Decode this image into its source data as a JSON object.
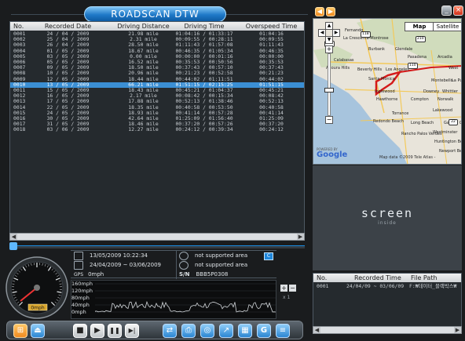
{
  "app": {
    "title": "ROADSCAN DTW"
  },
  "window_buttons": {
    "minimize": "_",
    "close": "×"
  },
  "main_list": {
    "columns": [
      "No.",
      "Recorded Date",
      "Driving Distance",
      "Driving Time",
      "Overspeed Time"
    ],
    "rows": [
      [
        "0001",
        "24 / 04 / 2009",
        "21.98 mile",
        "01:04:16 / 01:33:17",
        "01:04:16"
      ],
      [
        "0002",
        "25 / 04 / 2009",
        "2.31 mile",
        "00:09:55 / 00:28:11",
        "00:09:55"
      ],
      [
        "0003",
        "26 / 04 / 2009",
        "28.50 mile",
        "01:11:43 / 01:57:08",
        "01:11:43"
      ],
      [
        "0004",
        "01 / 05 / 2009",
        "18.67 mile",
        "00:46:35 / 01:05:34",
        "00:46:35"
      ],
      [
        "0005",
        "03 / 05 / 2009",
        "0.00 mile",
        "00:00:00 / 00:01:16",
        "00:00:00"
      ],
      [
        "0006",
        "05 / 05 / 2009",
        "16.52 mile",
        "00:35:53 / 00:50:56",
        "00:35:53"
      ],
      [
        "0007",
        "09 / 05 / 2009",
        "18.50 mile",
        "00:37:43 / 00:57:10",
        "00:37:43"
      ],
      [
        "0008",
        "10 / 05 / 2009",
        "20.96 mile",
        "00:21:23 / 00:52:58",
        "00:21:23"
      ],
      [
        "0009",
        "12 / 05 / 2009",
        "18.44 mile",
        "00:44:02 / 01:11:51",
        "00:44:02"
      ],
      [
        "0010",
        "13 / 05 / 2009",
        "66.21 mile",
        "01:51:15 / 02:15:25",
        "01:51:15"
      ],
      [
        "0011",
        "15 / 05 / 2009",
        "18.43 mile",
        "00:45:21 / 01:04:37",
        "00:45:21"
      ],
      [
        "0012",
        "16 / 05 / 2009",
        "2.17 mile",
        "00:08:42 / 00:15:34",
        "00:08:42"
      ],
      [
        "0013",
        "17 / 05 / 2009",
        "17.88 mile",
        "00:52:13 / 01:38:46",
        "00:52:13"
      ],
      [
        "0014",
        "22 / 05 / 2009",
        "18.35 mile",
        "00:40:58 / 00:53:50",
        "00:40:58"
      ],
      [
        "0015",
        "24 / 05 / 2009",
        "18.93 mile",
        "00:41:14 / 00:57:28",
        "00:41:14"
      ],
      [
        "0016",
        "30 / 05 / 2009",
        "42.64 mile",
        "01:25:09 / 01:56:40",
        "01:25:09"
      ],
      [
        "0017",
        "31 / 05 / 2009",
        "18.46 mile",
        "00:37:20 / 00:57:26",
        "00:37:20"
      ],
      [
        "0018",
        "03 / 06 / 2009",
        "12.27 mile",
        "00:24:12 / 00:39:34",
        "00:24:12"
      ]
    ],
    "selected_index": 9
  },
  "scrollbar": {
    "left_arrow": "◀",
    "right_arrow": "▶"
  },
  "info": {
    "datetime": "13/05/2009 10:22:34",
    "date_range": "24/04/2009 ~ 03/06/2009",
    "speed": "0mph",
    "speed_icon_label": "GPS",
    "area_1": "not supported area",
    "area_2": "not supported area",
    "sn_label": "S/N",
    "serial": "BBB5P0308",
    "corner_badge": "C"
  },
  "gauge": {
    "readout": "0mph",
    "max_mph": 160
  },
  "speed_graph": {
    "y_labels": [
      "160mph",
      "120mph",
      "80mph",
      "40mph",
      "0mph"
    ],
    "zoom_in": "+",
    "zoom_out": "−",
    "zoom_level": "x 1"
  },
  "toolbar": {
    "buttons": [
      "menu",
      "eject",
      "stop",
      "play",
      "pause",
      "next",
      "usb",
      "print",
      "gps",
      "export",
      "keyboard",
      "google",
      "memo"
    ],
    "labels": {
      "eject": "⏏",
      "stop": "■",
      "play": "▶",
      "pause": "❚❚",
      "next": "▶|",
      "google": "G"
    }
  },
  "map": {
    "map_button": "Map",
    "satellite_button": "Satellite",
    "footer": "Map data ©2009 Tele Atlas -",
    "powered_by": "POWERED BY",
    "logo": "Google",
    "places": [
      {
        "name": "Fernando"
      },
      {
        "name": "La Crescenta-Montrose"
      },
      {
        "name": "Burbank"
      },
      {
        "name": "Glendale"
      },
      {
        "name": "Pasadena"
      },
      {
        "name": "Arcadia"
      },
      {
        "name": "Calabasas"
      },
      {
        "name": "Agoura Hills"
      },
      {
        "name": "Beverly Hills"
      },
      {
        "name": "Los Angeles"
      },
      {
        "name": "West"
      },
      {
        "name": "Santa Monica"
      },
      {
        "name": "Montebello"
      },
      {
        "name": "La Puen"
      },
      {
        "name": "Inglewood"
      },
      {
        "name": "Downey"
      },
      {
        "name": "Whittier"
      },
      {
        "name": "Hawthorne"
      },
      {
        "name": "Compton"
      },
      {
        "name": "Norwalk"
      },
      {
        "name": "Torrance"
      },
      {
        "name": "Lakewood"
      },
      {
        "name": "Redondo Beach"
      },
      {
        "name": "Long Beach"
      },
      {
        "name": "Rancho Palos Verdes"
      },
      {
        "name": "Westminster"
      },
      {
        "name": "Huntington Beach"
      },
      {
        "name": "Newport Beach"
      },
      {
        "name": "Garden Grove"
      }
    ],
    "shields": [
      "118",
      "101",
      "210",
      "110",
      "22"
    ]
  },
  "screen_inside": {
    "logo": "screen",
    "sub": "inside"
  },
  "records": {
    "columns": [
      "No.",
      "Recorded Time",
      "File Path"
    ],
    "rows": [
      [
        "0001",
        "24/04/09 ~ 03/06/09",
        "F:₩데이터_블랙박스₩"
      ]
    ]
  }
}
